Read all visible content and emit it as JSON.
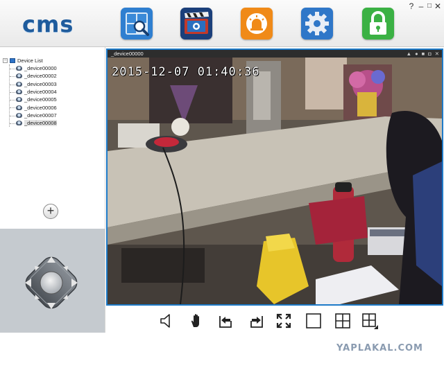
{
  "app": {
    "logo_text": "cms",
    "window_controls": [
      "?",
      "–",
      "□",
      "✕"
    ]
  },
  "toolbar": {
    "buttons": [
      {
        "icon": "search-device-icon",
        "color": "#2f7fd0"
      },
      {
        "icon": "playback-clapper-icon",
        "color": "#1b3f7a"
      },
      {
        "icon": "alarm-light-icon",
        "color": "#f08a18"
      },
      {
        "icon": "settings-gear-icon",
        "color": "#2f77c8"
      },
      {
        "icon": "lock-icon",
        "color": "#3bb144"
      }
    ]
  },
  "device_tree": {
    "root_label": "Device List",
    "devices": [
      "_device00000",
      "_device00002",
      "_device00003",
      "_device00004",
      "_device00005",
      "_device00006",
      "_device00007",
      "_device00008"
    ],
    "selected": "_device00008"
  },
  "left_panel": {
    "add_label": "+"
  },
  "video": {
    "channel_title": "_device00000",
    "osd_timestamp": "2015-12-07 01:40:36",
    "status_icons": [
      "alarm-icon",
      "microphone-icon",
      "record-icon",
      "snapshot-icon",
      "close-icon"
    ]
  },
  "bottom_toolbar": [
    "speaker-icon",
    "hand-icon",
    "previous-icon",
    "next-icon",
    "fullscreen-icon",
    "single-view-icon",
    "quad-view-icon",
    "multi-view-icon"
  ],
  "footer": {
    "watermark": "YAPLAKAL.COM"
  },
  "colors": {
    "accent": "#1d7ac8",
    "toolbar_bg": "#eeeeee",
    "ptz_bg": "#c5cacf"
  }
}
